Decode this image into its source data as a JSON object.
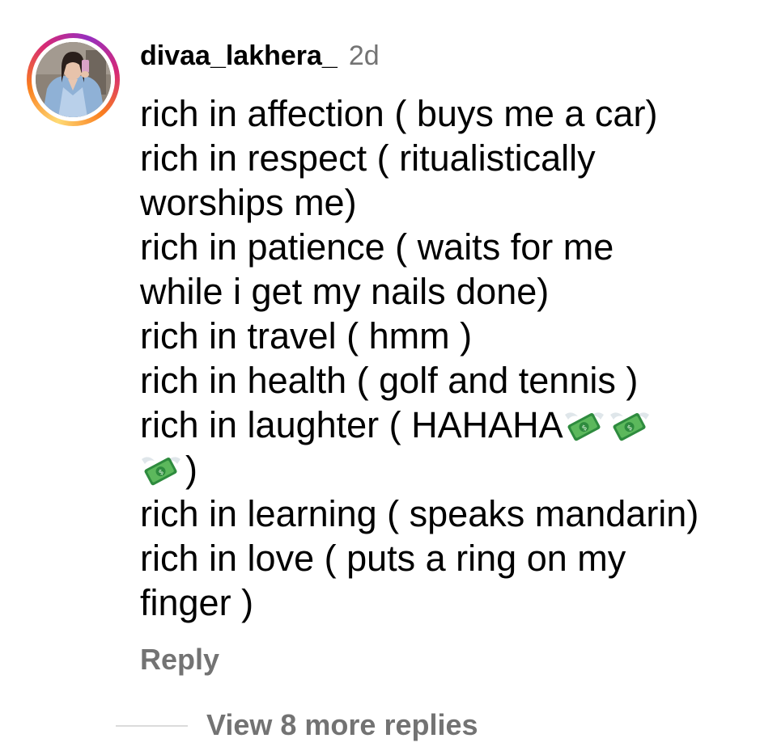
{
  "comment": {
    "username": "divaa_lakhera_",
    "timestamp": "2d",
    "avatar_icon": "profile-photo",
    "lines": [
      "rich in affection ( buys me a car)",
      "rich in respect ( ritualistically",
      "worships me)",
      "rich in patience ( waits for me",
      "while i get my nails done)",
      "rich in travel ( hmm )",
      "rich in health ( golf and tennis )",
      "rich in laughter ( HAHAHA",
      ")",
      "rich in learning ( speaks mandarin)",
      "rich in love ( puts a ring on my",
      "finger )"
    ],
    "emoji": {
      "name": "money-with-wings-icon",
      "count": 3,
      "glyph": "💸"
    },
    "reply_label": "Reply",
    "view_replies_label": "View 8 more replies"
  },
  "colors": {
    "text": "#000000",
    "secondary_text": "#737373",
    "divider": "#dbdbdb",
    "story_ring": [
      "#feda75",
      "#fa7e1e",
      "#d62976",
      "#962fbf"
    ]
  }
}
